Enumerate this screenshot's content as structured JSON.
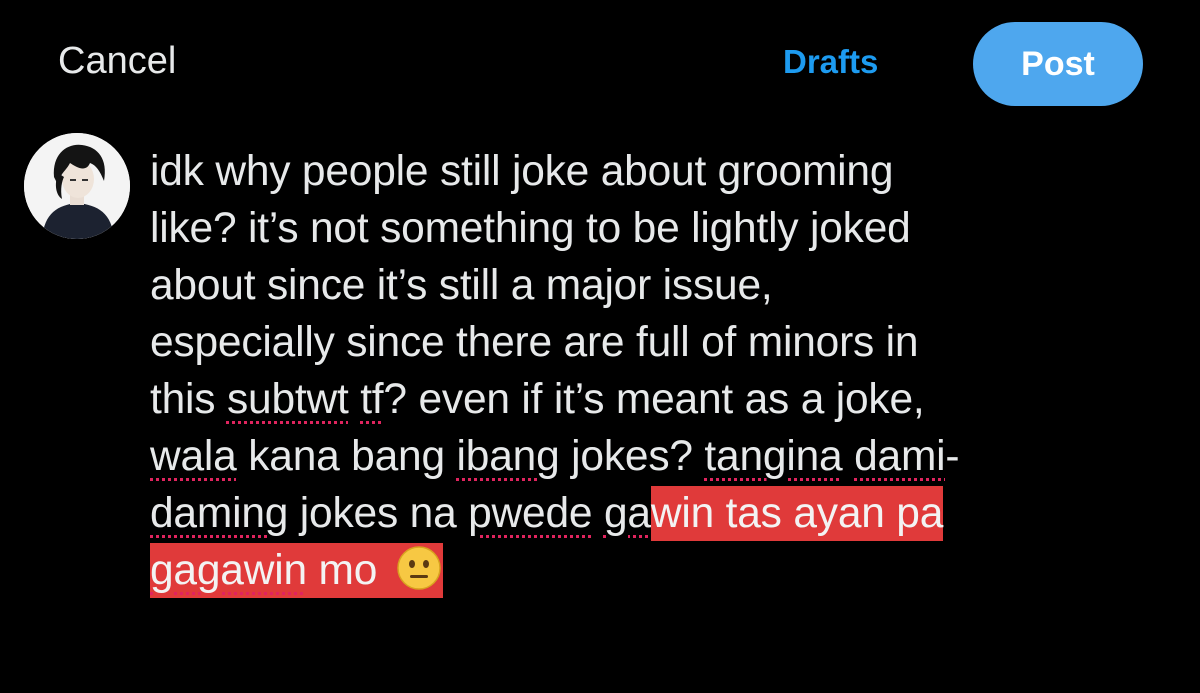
{
  "header": {
    "cancel_label": "Cancel",
    "drafts_label": "Drafts",
    "post_label": "Post"
  },
  "colors": {
    "background": "#000000",
    "accent": "#1d9bf0",
    "post_button": "#4ea7ee",
    "highlight": "#e03a3a",
    "spellcheck_underline": "#e0245e"
  },
  "composer": {
    "avatar_icon": "user-avatar-icon",
    "lines": [
      {
        "segments": [
          {
            "text": "idk why people still joke about grooming"
          }
        ]
      },
      {
        "segments": [
          {
            "text": "like? it’s not something to be lightly joked"
          }
        ]
      },
      {
        "segments": [
          {
            "text": "about since it’s still a major issue,"
          }
        ]
      },
      {
        "segments": [
          {
            "text": "especially since there are full of minors in"
          }
        ]
      },
      {
        "segments": [
          {
            "text": "this "
          },
          {
            "text": "subtwt",
            "misspelled": true
          },
          {
            "text": " "
          },
          {
            "text": "tf",
            "misspelled": true
          },
          {
            "text": "? even if it’s meant as a joke,"
          }
        ]
      },
      {
        "segments": [
          {
            "text": "wala",
            "misspelled": true
          },
          {
            "text": " kana bang "
          },
          {
            "text": "ibang",
            "misspelled": true
          },
          {
            "text": " jokes? "
          },
          {
            "text": "tangina",
            "misspelled": true
          },
          {
            "text": " "
          },
          {
            "text": "dami",
            "misspelled": true
          },
          {
            "text": "-"
          }
        ]
      },
      {
        "segments": [
          {
            "text": "daming",
            "misspelled": true
          },
          {
            "text": " jokes na "
          },
          {
            "text": "pwede",
            "misspelled": true
          },
          {
            "text": " "
          },
          {
            "text": "ga",
            "misspelled": true
          },
          {
            "text": "win tas ayan pa",
            "highlight": true
          }
        ]
      },
      {
        "segments": [
          {
            "text": "gagawin",
            "misspelled": true,
            "highlight": true
          },
          {
            "text": " mo ",
            "highlight": true
          },
          {
            "emoji": "neutral-face-emoji",
            "highlight": true
          }
        ]
      }
    ]
  }
}
